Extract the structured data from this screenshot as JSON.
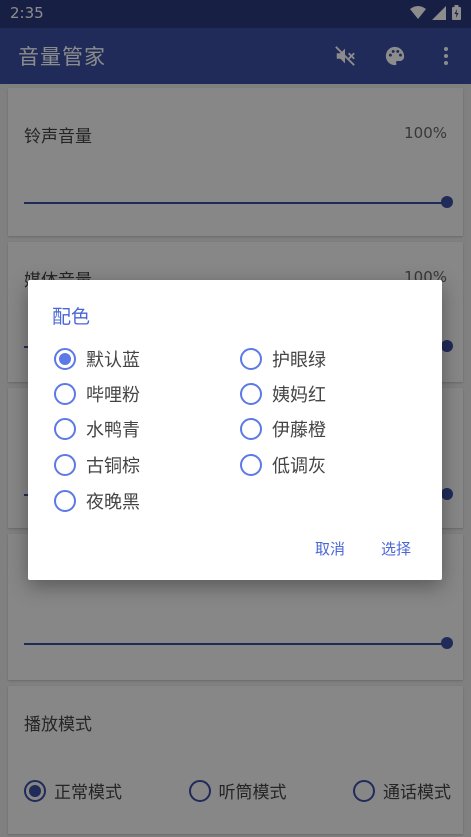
{
  "status": {
    "time": "2:35"
  },
  "appbar": {
    "title": "音量管家",
    "mute_icon": "volume-off-icon",
    "palette_icon": "palette-icon",
    "more_icon": "more-vert-icon"
  },
  "cards": [
    {
      "label": "铃声音量",
      "value": "100%",
      "fill": 1.0
    },
    {
      "label": "媒体音量",
      "value": "100%",
      "fill": 1.0
    },
    {
      "fill": 1.0
    },
    {
      "fill": 1.0
    }
  ],
  "play_mode": {
    "label": "播放模式",
    "options": [
      {
        "label": "正常模式",
        "checked": true
      },
      {
        "label": "听筒模式",
        "checked": false
      },
      {
        "label": "通话模式",
        "checked": false
      }
    ]
  },
  "dialog": {
    "title": "配色",
    "options": [
      {
        "label": "默认蓝",
        "checked": true
      },
      {
        "label": "护眼绿",
        "checked": false
      },
      {
        "label": "哔哩粉",
        "checked": false
      },
      {
        "label": "姨妈红",
        "checked": false
      },
      {
        "label": "水鸭青",
        "checked": false
      },
      {
        "label": "伊藤橙",
        "checked": false
      },
      {
        "label": "古铜棕",
        "checked": false
      },
      {
        "label": "低调灰",
        "checked": false
      },
      {
        "label": "夜晚黑",
        "checked": false
      }
    ],
    "cancel": "取消",
    "confirm": "选择"
  },
  "colors": {
    "primary": "#3b4fa3",
    "statusbar": "#2b3a7f",
    "dialog_accent": "#4a67d6"
  }
}
